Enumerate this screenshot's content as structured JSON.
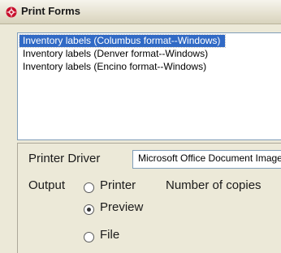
{
  "window": {
    "title": "Print Forms",
    "icon": "app-icon"
  },
  "forms_list": {
    "items": [
      {
        "label": "Inventory labels (Columbus format--Windows)",
        "selected": true
      },
      {
        "label": "Inventory labels (Denver format--Windows)",
        "selected": false
      },
      {
        "label": "Inventory labels (Encino format--Windows)",
        "selected": false
      }
    ]
  },
  "printer": {
    "driver_label": "Printer Driver",
    "driver_value": "Microsoft Office Document Image Writer"
  },
  "output": {
    "label": "Output",
    "options": [
      {
        "label": "Printer",
        "selected": false
      },
      {
        "label": "Preview",
        "selected": true
      },
      {
        "label": "File",
        "selected": false
      }
    ],
    "copies_label": "Number of copies"
  },
  "colors": {
    "selection": "#316ac5",
    "panel_bg": "#ece9d8"
  }
}
